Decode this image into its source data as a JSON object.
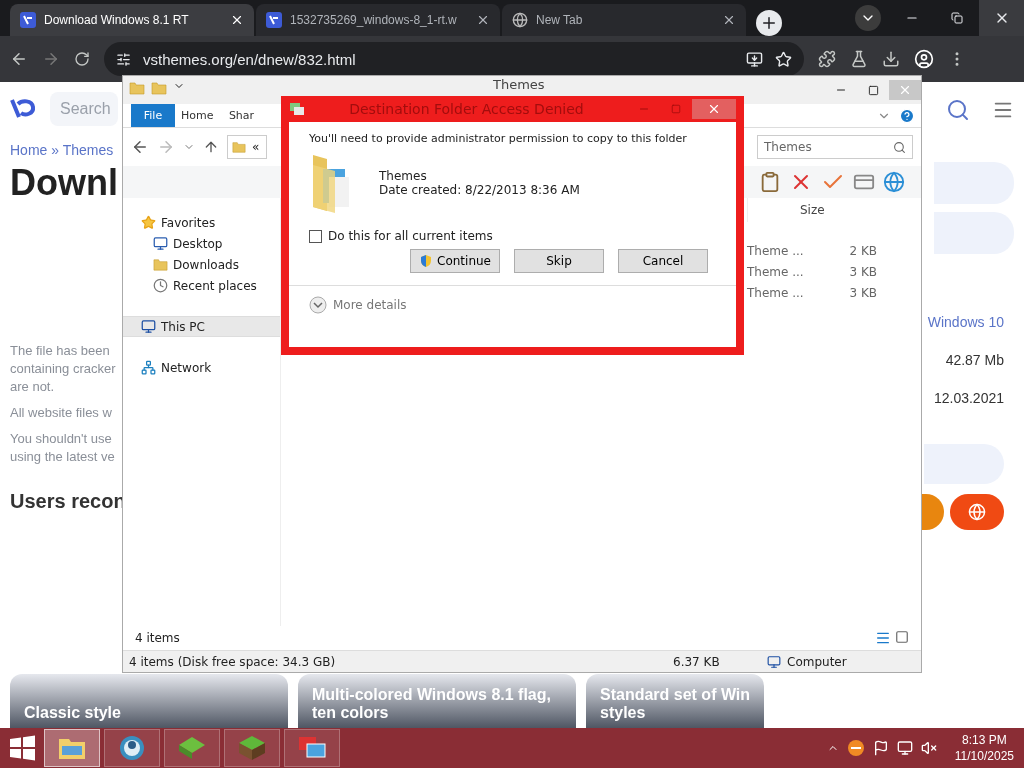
{
  "browser": {
    "tabs": [
      {
        "title": "Download Windows 8.1 RT",
        "kind": "site",
        "selected": true
      },
      {
        "title": "1532735269_windows-8_1-rt.w",
        "kind": "site",
        "selected": false
      },
      {
        "title": "New Tab",
        "kind": "chrome",
        "selected": false
      }
    ],
    "address": "vsthemes.org/en/dnew/832.html"
  },
  "website": {
    "search": {
      "placeholder": "Search"
    },
    "breadcrumb": "Home » Themes",
    "heading": "Downl",
    "paragraphs": [
      {
        "lines": [
          "The file has been",
          "containing cracker",
          "are not."
        ]
      },
      {
        "lines": [
          "All website files w"
        ]
      },
      {
        "lines": [
          "You shouldn't use",
          "using the latest ve"
        ]
      }
    ],
    "section_title": "Users recon",
    "details": {
      "link": "Windows 10",
      "size": "42.87 Mb",
      "date": "12.03.2021"
    },
    "cards": [
      {
        "lines": [
          "Classic style"
        ]
      },
      {
        "lines": [
          "Multi-colored Windows 8.1 flag,",
          "ten colors"
        ]
      },
      {
        "lines": [
          "Standard set of Win",
          "styles"
        ]
      }
    ]
  },
  "explorer": {
    "title": "Themes",
    "ribbon_tabs": [
      {
        "label": "File",
        "selected": true
      },
      {
        "label": "Home",
        "selected": false
      },
      {
        "label": "Shar",
        "selected": false
      }
    ],
    "address": "«",
    "search": {
      "placeholder": "Themes"
    },
    "nav": [
      {
        "label": "Favorites",
        "kind": "star",
        "selected": false,
        "children": [
          {
            "label": "Desktop",
            "kind": "desktop",
            "selected": false
          },
          {
            "label": "Downloads",
            "kind": "downloads",
            "selected": false
          },
          {
            "label": "Recent places",
            "kind": "recent",
            "selected": false
          }
        ]
      },
      {
        "label": "This PC",
        "kind": "pc",
        "selected": true
      },
      {
        "label": "Network",
        "kind": "network",
        "selected": false
      }
    ],
    "size_column": "Size",
    "files": [
      {
        "type": "Theme ...",
        "size": "2 KB"
      },
      {
        "type": "Theme ...",
        "size": "3 KB"
      },
      {
        "type": "Theme ...",
        "size": "3 KB"
      }
    ],
    "item_count": "4 items",
    "status": {
      "items": "4 items (Disk free space: 34.3 GB)",
      "size": "6.37 KB",
      "location": "Computer"
    }
  },
  "dialog": {
    "title": "Destination Folder Access Denied",
    "message": "You'll need to provide administrator permission to copy to this folder",
    "folder_name": "Themes",
    "date_created": "Date created: 8/22/2013 8:36 AM",
    "apply_all": {
      "label": "Do this for all current items",
      "checked": false
    },
    "buttons": [
      {
        "label": "Continue",
        "kind": "shield"
      },
      {
        "label": "Skip",
        "kind": "plain"
      },
      {
        "label": "Cancel",
        "kind": "plain"
      }
    ],
    "more_details": "More details"
  },
  "taskbar": {
    "apps": [
      {
        "kind": "explorer",
        "selected": true
      },
      {
        "kind": "globe",
        "selected": false
      },
      {
        "kind": "block",
        "selected": false
      },
      {
        "kind": "grass",
        "selected": false
      },
      {
        "kind": "remote",
        "selected": false
      }
    ],
    "time": "8:13 PM",
    "date": "11/10/2025"
  }
}
